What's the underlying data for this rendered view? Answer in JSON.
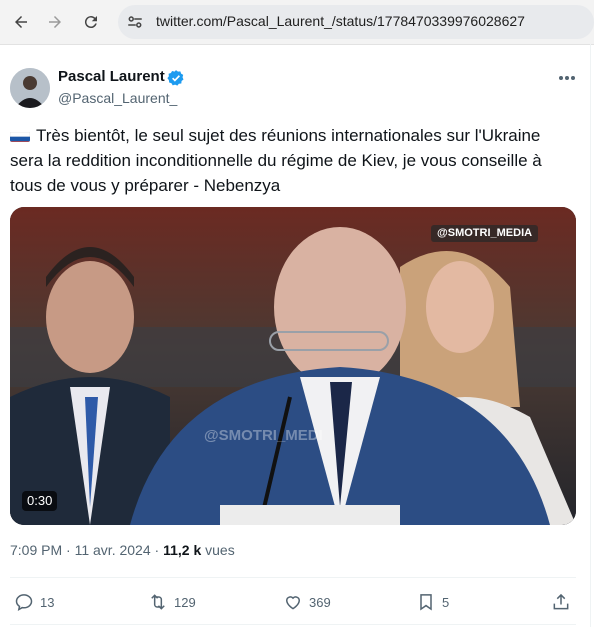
{
  "browser": {
    "url": "twitter.com/Pascal_Laurent_/status/1778470339976028627"
  },
  "tweet": {
    "author_name": "Pascal Laurent",
    "handle": "@Pascal_Laurent_",
    "text": "Très bientôt, le seul sujet des réunions internationales sur l'Ukraine sera la reddition inconditionnelle du régime de Kiev, je vous conseille à tous de vous y préparer - Nebenzya",
    "flag_icon": "russia-flag-icon",
    "video": {
      "watermark": "@SMOTRI_MEDIA",
      "overlay_watermark": "@SMOTRI_MEDI",
      "duration": "0:30"
    },
    "time": "7:09 PM",
    "date": "11 avr. 2024",
    "views_count": "11,2 k",
    "views_label": "vues"
  },
  "actions": {
    "replies": "13",
    "retweets": "129",
    "likes": "369",
    "bookmarks": "5"
  },
  "colors": {
    "accent": "#1d9bf0",
    "text_primary": "#0f1419",
    "text_secondary": "#536471"
  }
}
